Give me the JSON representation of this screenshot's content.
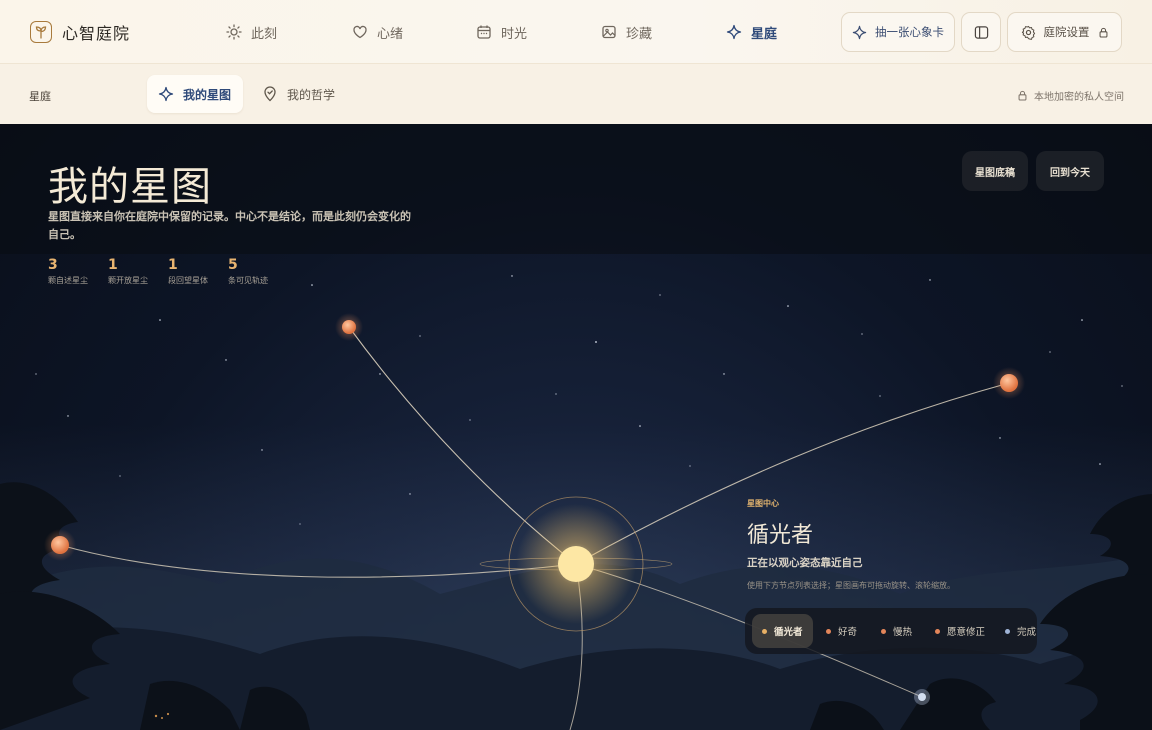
{
  "app": {
    "name": "心智庭院"
  },
  "nav": {
    "items": [
      {
        "label": "此刻",
        "icon": "sun-icon"
      },
      {
        "label": "心绪",
        "icon": "heart-icon"
      },
      {
        "label": "时光",
        "icon": "calendar-icon"
      },
      {
        "label": "珍藏",
        "icon": "image-icon"
      },
      {
        "label": "星庭",
        "icon": "sparkle-icon",
        "active": true
      }
    ],
    "draw_card": "抽一张心象卡",
    "settings": "庭院设置"
  },
  "subnav": {
    "title": "星庭",
    "tabs": [
      {
        "label": "我的星图",
        "icon": "sparkle-icon",
        "active": true
      },
      {
        "label": "我的哲学",
        "icon": "map-pin-icon"
      }
    ],
    "privacy": "本地加密的私人空间"
  },
  "starmap": {
    "title": "我的星图",
    "description": "星图直接来自你在庭院中保留的记录。中心不是结论，而是此刻仍会变化的自己。",
    "stats": [
      {
        "value": "3",
        "label": "颗自述星尘"
      },
      {
        "value": "1",
        "label": "颗开放星尘"
      },
      {
        "value": "1",
        "label": "段回望星体"
      },
      {
        "value": "5",
        "label": "条可见轨迹"
      }
    ],
    "actions": {
      "draft": "星图底稿",
      "today": "回到今天"
    }
  },
  "center": {
    "tag": "星图中心",
    "title": "循光者",
    "subtitle": "正在以观心姿态靠近自己",
    "hint": "使用下方节点列表选择；星图画布可拖动旋转、滚轮缩放。"
  },
  "chips": [
    {
      "label": "循光者",
      "color": "#e8b065",
      "active": true
    },
    {
      "label": "好奇",
      "color": "#e3865a"
    },
    {
      "label": "慢热",
      "color": "#e3865a"
    },
    {
      "label": "愿意修正",
      "color": "#e3865a"
    },
    {
      "label": "完成",
      "color": "#9fb4d6"
    }
  ],
  "colors": {
    "accent": "#2f4a7a",
    "gold": "#e8b470",
    "sky": "#0d1526"
  }
}
